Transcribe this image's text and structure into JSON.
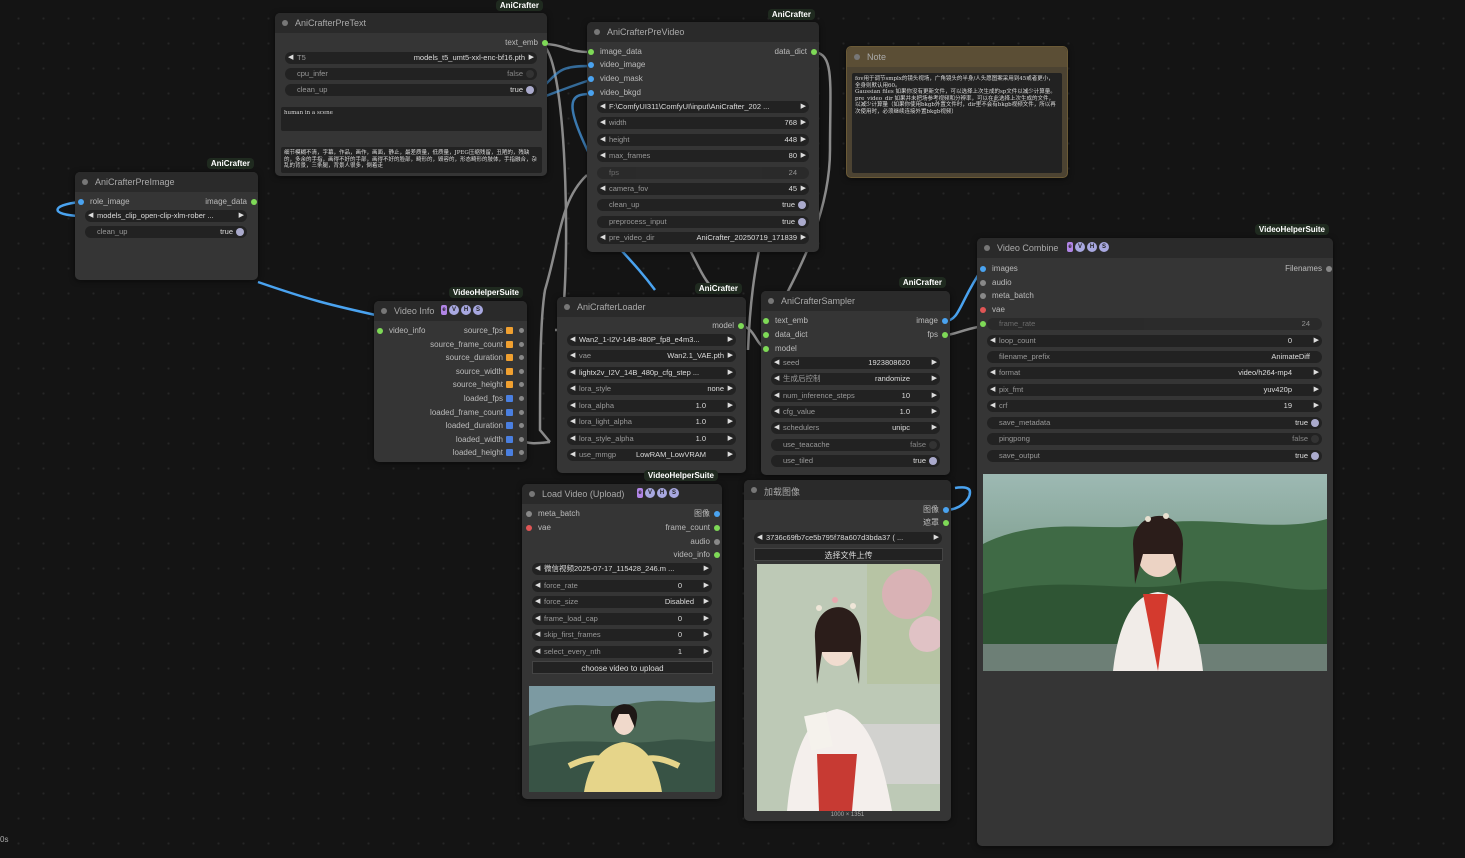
{
  "colors": {
    "accent_blue": "#4aa3f0",
    "green": "#7ed957",
    "canvas": "#141414",
    "node": "#353535",
    "note": "#4c4332"
  },
  "pre_text": {
    "title": "AniCrafterPreText",
    "badge": "AniCrafter",
    "out": "text_emb",
    "t5_name": "T5",
    "t5_value": "models_t5_umt5-xxl-enc-bf16.pth",
    "cpu_infer_name": "cpu_infer",
    "cpu_infer_value": "false",
    "clean_up_name": "clean_up",
    "clean_up_value": "true",
    "prompt": "human in a scene",
    "negative": "细节模糊不清，字幕，作品，画作，画面，静止，最差质量，低质量，JPEG压缩残留，丑陋的，残缺的，多余的手指，画得不好的手部，画得不好的脸部，畸形的，毁容的，形态畸形的肢体，手指融合，杂乱的背景，三条腿，背景人很多，倒着走"
  },
  "pre_image": {
    "title": "AniCrafterPreImage",
    "badge": "AniCrafter",
    "in": "role_image",
    "out": "image_data",
    "clip_value": "models_clip_open-clip-xlm-rober ...",
    "clean_up_name": "clean_up",
    "clean_up_value": "true"
  },
  "pre_video": {
    "title": "AniCrafterPreVideo",
    "badge": "AniCrafter",
    "inputs": [
      "image_data",
      "video_image",
      "video_mask",
      "video_bkgd"
    ],
    "out": "data_dict",
    "path": "F:\\ComfyUI311\\ComfyUI\\input\\AniCrafter_202 ...",
    "width_name": "width",
    "width": "768",
    "height_name": "height",
    "height": "448",
    "max_frames_name": "max_frames",
    "max_frames": "80",
    "fps_name": "fps",
    "fps": "24",
    "camera_fov_name": "camera_fov",
    "camera_fov": "45",
    "clean_up_name": "clean_up",
    "clean_up": "true",
    "preprocess_name": "preprocess_input",
    "preprocess": "true",
    "pre_video_dir_name": "pre_video_dir",
    "pre_video_dir": "AniCrafter_20250719_171839"
  },
  "note": {
    "title": "Note",
    "text": "fov用于调节smplx的镜头视场，广角镜头的半身/人头愿图案采用到45或者更小，全身则默认用60。\nGaussian files 如果你没有更新文件，可以选择上次生成的sp文件以减少计算量。\npre_video_dir 如果并未把场参考视频和分辨率，可以在此选择上次生成的文件，以减少计算量（如果你使用bkgb外置文件时，dir里不会有bkgb视频文件，所以再次使用时，必须继续连接外置bkgb视频）"
  },
  "video_info": {
    "title": "Video Info",
    "badge": "VideoHelperSuite",
    "in": "video_info",
    "outputs": [
      "source_fps",
      "source_frame_count",
      "source_duration",
      "source_width",
      "source_height",
      "loaded_fps",
      "loaded_frame_count",
      "loaded_duration",
      "loaded_width",
      "loaded_height"
    ]
  },
  "loader": {
    "title": "AniCrafterLoader",
    "badge": "AniCrafter",
    "out": "model",
    "model_value": "Wan2_1-I2V-14B-480P_fp8_e4m3...",
    "vae_name": "vae",
    "vae_value": "Wan2.1_VAE.pth",
    "lora_value": "lightx2v_I2V_14B_480p_cfg_step ...",
    "lora_style_name": "lora_style",
    "lora_style": "none",
    "lora_alpha_name": "lora_alpha",
    "lora_alpha": "1.0",
    "lora_light_alpha_name": "lora_light_alpha",
    "lora_light_alpha": "1.0",
    "lora_style_alpha_name": "lora_style_alpha",
    "lora_style_alpha": "1.0",
    "use_mmgp_name": "use_mmgp",
    "use_mmgp": "LowRAM_LowVRAM"
  },
  "sampler": {
    "title": "AniCrafterSampler",
    "badge": "AniCrafter",
    "inputs": [
      "text_emb",
      "data_dict",
      "model"
    ],
    "out_image": "image",
    "out_fps": "fps",
    "seed_name": "seed",
    "seed": "1923808620",
    "control_name": "生成后控制",
    "control": "randomize",
    "steps_name": "num_inference_steps",
    "steps": "10",
    "cfg_name": "cfg_value",
    "cfg": "1.0",
    "sched_name": "schedulers",
    "sched": "unipc",
    "teacache_name": "use_teacache",
    "teacache": "false",
    "tiled_name": "use_tiled",
    "tiled": "true"
  },
  "combine": {
    "title": "Video Combine",
    "badge": "VideoHelperSuite",
    "inputs": [
      "images",
      "audio",
      "meta_batch",
      "vae"
    ],
    "out": "Filenames",
    "frame_rate_name": "frame_rate",
    "frame_rate": "24",
    "loop_name": "loop_count",
    "loop": "0",
    "prefix_name": "filename_prefix",
    "prefix": "AnimateDiff",
    "format_name": "format",
    "format": "video/h264-mp4",
    "pix_name": "pix_fmt",
    "pix": "yuv420p",
    "crf_name": "crf",
    "crf": "19",
    "meta_name": "save_metadata",
    "meta": "true",
    "ping_name": "pingpong",
    "ping": "false",
    "save_name": "save_output",
    "save": "true"
  },
  "load_video": {
    "title": "Load Video (Upload)",
    "badge": "VideoHelperSuite",
    "inputs": [
      "meta_batch",
      "vae"
    ],
    "outputs": [
      "图像",
      "frame_count",
      "audio",
      "video_info"
    ],
    "video_value": "微信视频2025-07-17_115428_246.m ...",
    "force_rate_name": "force_rate",
    "force_rate": "0",
    "force_size_name": "force_size",
    "force_size": "Disabled",
    "cap_name": "frame_load_cap",
    "cap": "0",
    "skip_name": "skip_first_frames",
    "skip": "0",
    "nth_name": "select_every_nth",
    "nth": "1",
    "upload_label": "choose video to upload"
  },
  "load_image": {
    "title": "加载图像",
    "outputs": [
      "图像",
      "遮罩"
    ],
    "image_value": "3736c69fb7ce5b795f78a607d3bda37 ( ...",
    "upload_label": "选择文件上传",
    "size": "1000 × 1351"
  },
  "status": {
    "corner": "0s"
  }
}
